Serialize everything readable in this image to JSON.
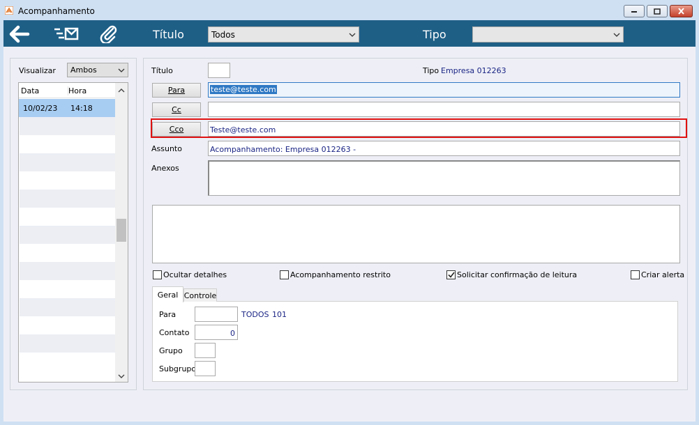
{
  "window": {
    "title": "Acompanhamento"
  },
  "toolbar": {
    "titulo_label": "Título",
    "titulo_value": "Todos",
    "tipo_label": "Tipo",
    "tipo_value": ""
  },
  "left_panel": {
    "visualizar_label": "Visualizar",
    "visualizar_value": "Ambos",
    "columns": [
      "Data",
      "Hora"
    ],
    "rows": [
      {
        "data": "10/02/23",
        "hora": "14:18"
      }
    ]
  },
  "form": {
    "titulo_label": "Título",
    "titulo_value": "",
    "tipo_label": "Tipo",
    "tipo_value": "Empresa 012263",
    "para_button": "Para",
    "para_value": "teste@teste.com",
    "cc_button": "Cc",
    "cc_value": "",
    "cco_button": "Cco",
    "cco_value": "Teste@teste.com",
    "assunto_label": "Assunto",
    "assunto_value": "Acompanhamento: Empresa 012263 -",
    "anexos_label": "Anexos",
    "body_text": ""
  },
  "checkboxes": [
    {
      "label": "Ocultar detalhes",
      "checked": false
    },
    {
      "label": "Acompanhamento restrito",
      "checked": false
    },
    {
      "label": "Solicitar confirmação de leitura",
      "checked": true
    },
    {
      "label": "Criar alerta",
      "checked": false
    }
  ],
  "tabs": [
    "Geral",
    "Controle"
  ],
  "geral": {
    "para_label": "Para",
    "para_value": "",
    "para_info_1": "TODOS",
    "para_info_2": "101",
    "contato_label": "Contato",
    "contato_value": "0",
    "grupo_label": "Grupo",
    "grupo_value": "",
    "subgrupo_label": "Subgrupo",
    "subgrupo_value": ""
  },
  "colors": {
    "toolbar": "#1e5f86",
    "highlight": "#e01010",
    "selection": "#a8cdf2",
    "navy_text": "#1a2484"
  }
}
